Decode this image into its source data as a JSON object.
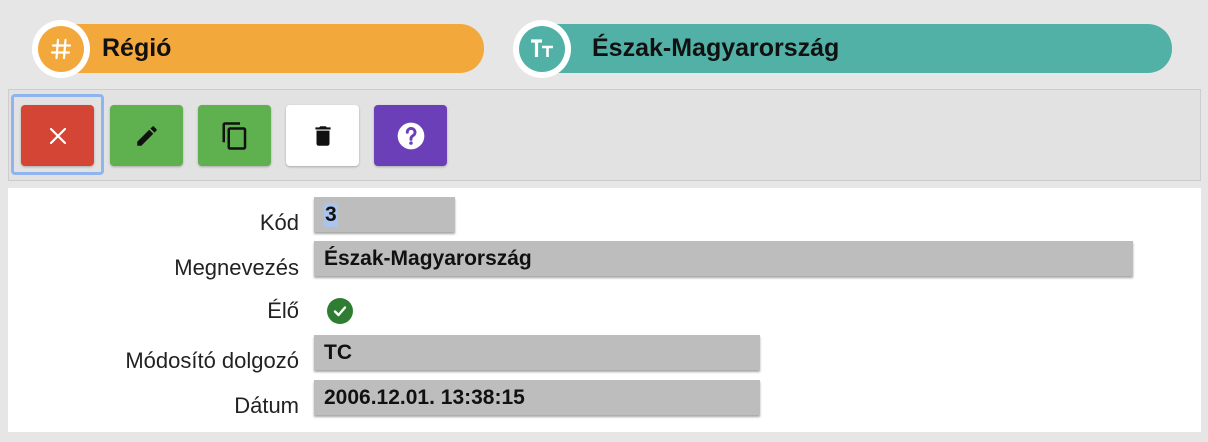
{
  "header": {
    "category": {
      "icon": "hash-icon",
      "label": "Régió",
      "color": "#f2a83b"
    },
    "record": {
      "icon": "text-type-icon",
      "label": "Észak-Magyarország",
      "color": "#52b1a7"
    }
  },
  "toolbar": {
    "buttons": [
      {
        "name": "close",
        "icon": "close-icon",
        "color": "#d44536",
        "focused": true
      },
      {
        "name": "edit",
        "icon": "pencil-icon",
        "color": "#5fb04f"
      },
      {
        "name": "copy",
        "icon": "copy-icon",
        "color": "#5fb04f"
      },
      {
        "name": "delete",
        "icon": "trash-icon",
        "color": "#ffffff"
      },
      {
        "name": "help",
        "icon": "help-icon",
        "color": "#6b3fb8"
      }
    ]
  },
  "form": {
    "kod": {
      "label": "Kód",
      "value": "3"
    },
    "megnevezes": {
      "label": "Megnevezés",
      "value": "Észak-Magyarország"
    },
    "elo": {
      "label": "Élő",
      "checked": true,
      "icon": "check-circle-icon"
    },
    "modosito": {
      "label": "Módosító dolgozó",
      "value": "TC"
    },
    "datum": {
      "label": "Dátum",
      "value": "2006.12.01. 13:38:15"
    }
  }
}
